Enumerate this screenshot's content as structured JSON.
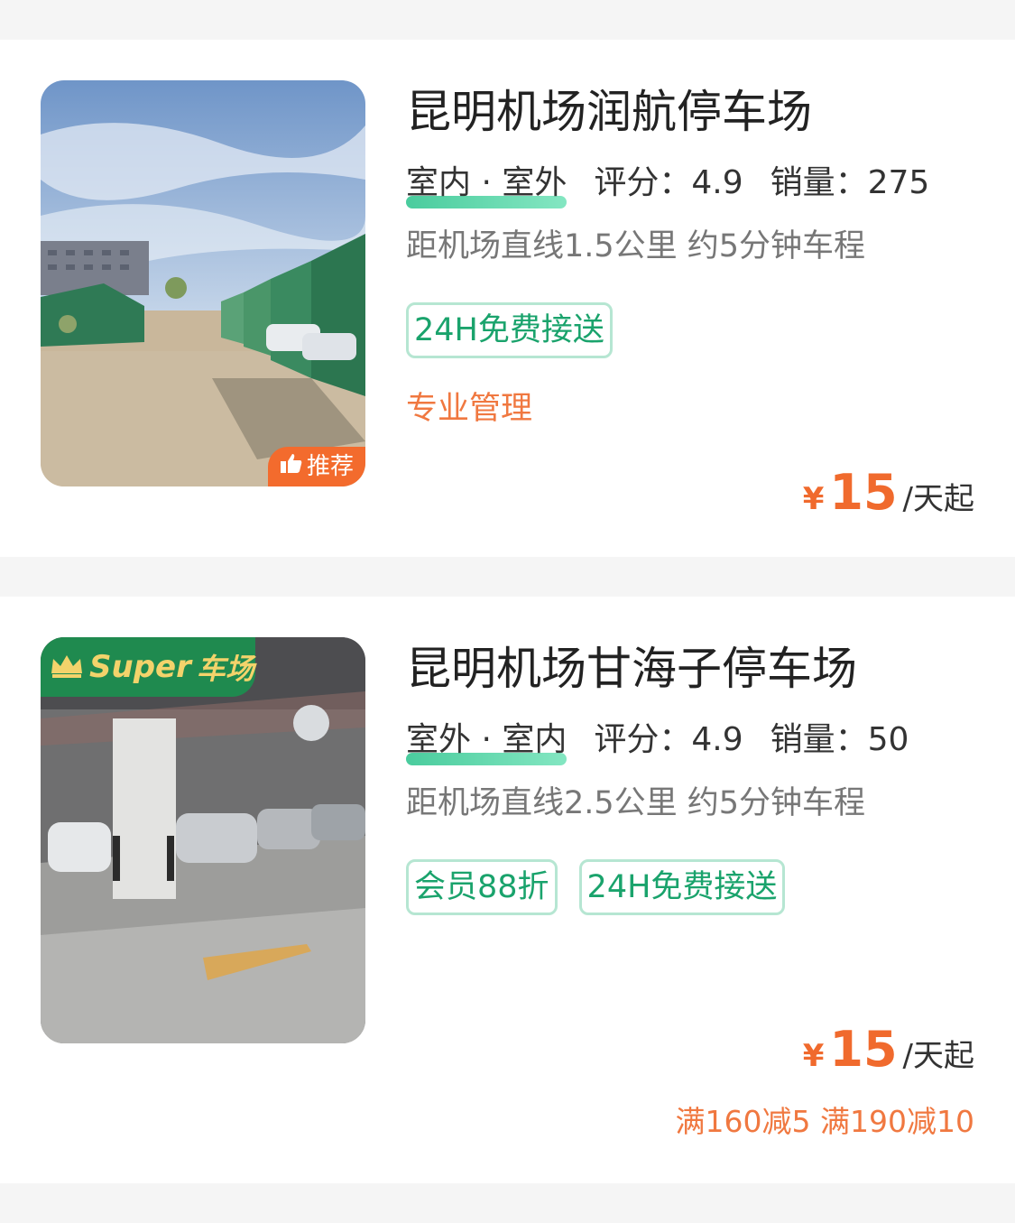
{
  "listings": [
    {
      "title": "昆明机场润航停车场",
      "type_label": "室内 · 室外",
      "rating_label": "评分：4.9",
      "sales_label": "销量：275",
      "distance": "距机场直线1.5公里 约5分钟车程",
      "tags": [
        "24H免费接送"
      ],
      "feature": "专业管理",
      "currency": "¥",
      "price": "15",
      "price_unit": "/天起",
      "badge": "推荐",
      "badge_icon": "thumbs-up-icon"
    },
    {
      "title": "昆明机场甘海子停车场",
      "type_label": "室外 · 室内",
      "rating_label": "评分：4.9",
      "sales_label": "销量：50",
      "distance": "距机场直线2.5公里 约5分钟车程",
      "tags": [
        "会员88折",
        "24H免费接送"
      ],
      "currency": "¥",
      "price": "15",
      "price_unit": "/天起",
      "promo": "满160减5 满190减10",
      "super_badge": {
        "prefix": "Super",
        "suffix": "车场",
        "icon": "crown-icon"
      }
    }
  ],
  "colors": {
    "accent": "#f06a2d",
    "green": "#1aa36c",
    "tag_border": "#b6e6d2"
  }
}
